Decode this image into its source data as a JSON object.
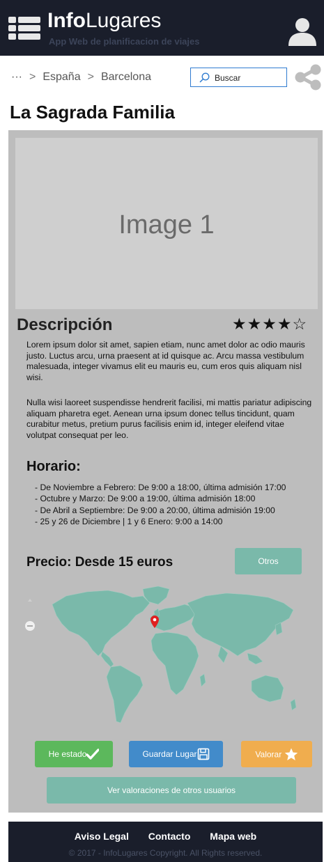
{
  "header": {
    "brand_bold": "Info",
    "brand_light": "Lugares",
    "tagline": "App Web de planificacion de viajes",
    "menu_icon": "hamburger-grid-icon",
    "user_icon": "user-icon"
  },
  "breadcrumb": {
    "ellipsis": "···",
    "items": [
      "España",
      "Barcelona"
    ],
    "separator": ">"
  },
  "search": {
    "placeholder": "Buscar"
  },
  "page": {
    "title": "La Sagrada Familia"
  },
  "image": {
    "label": "Image 1"
  },
  "description": {
    "heading": "Descripción",
    "rating": 4,
    "rating_max": 5,
    "paragraphs": [
      "Lorem ipsum dolor sit amet, sapien etiam, nunc amet dolor ac odio mauris justo. Luctus arcu, urna praesent at id quisque ac. Arcu massa vestibulum malesuada, integer vivamus elit eu mauris eu, cum eros quis aliquam nisl wisi.",
      "Nulla wisi laoreet suspendisse hendrerit facilisi, mi mattis pariatur adipiscing aliquam pharetra eget. Aenean urna ipsum donec tellus tincidunt, quam curabitur metus, pretium purus facilisis enim id, integer eleifend vitae volutpat consequat per leo."
    ]
  },
  "horario": {
    "heading": "Horario:",
    "items": [
      "- De Noviembre a Febrero: De 9:00 a 18:00, última admisión 17:00",
      "- Octubre y Marzo: De 9:00 a 19:00, última admisión 18:00",
      "- De Abril a Septiembre: De 9:00 a 20:00, última admisión 19:00",
      "- 25 y 26 de Diciembre | 1 y 6 Enero: 9:00 a 14:00"
    ]
  },
  "price": {
    "label": "Precio: Desde 15  euros",
    "otros_button": "Otros"
  },
  "actions": {
    "estado": "He estado",
    "guardar": "Guardar Lugar",
    "valorar": "Valorar",
    "ver_valoraciones": "Ver valoraciones de otros usuarios"
  },
  "colors": {
    "header_bg": "#1a1e2b",
    "teal": "#7ab9aa",
    "green": "#5cb85c",
    "blue": "#428bca",
    "orange": "#f0ad4e",
    "map_land": "#7ab9aa",
    "pin": "#e02020"
  },
  "footer": {
    "links": [
      "Aviso Legal",
      "Contacto",
      "Mapa web"
    ],
    "copyright": "© 2017 - InfoLugares Copyright. All Rights reserved."
  }
}
